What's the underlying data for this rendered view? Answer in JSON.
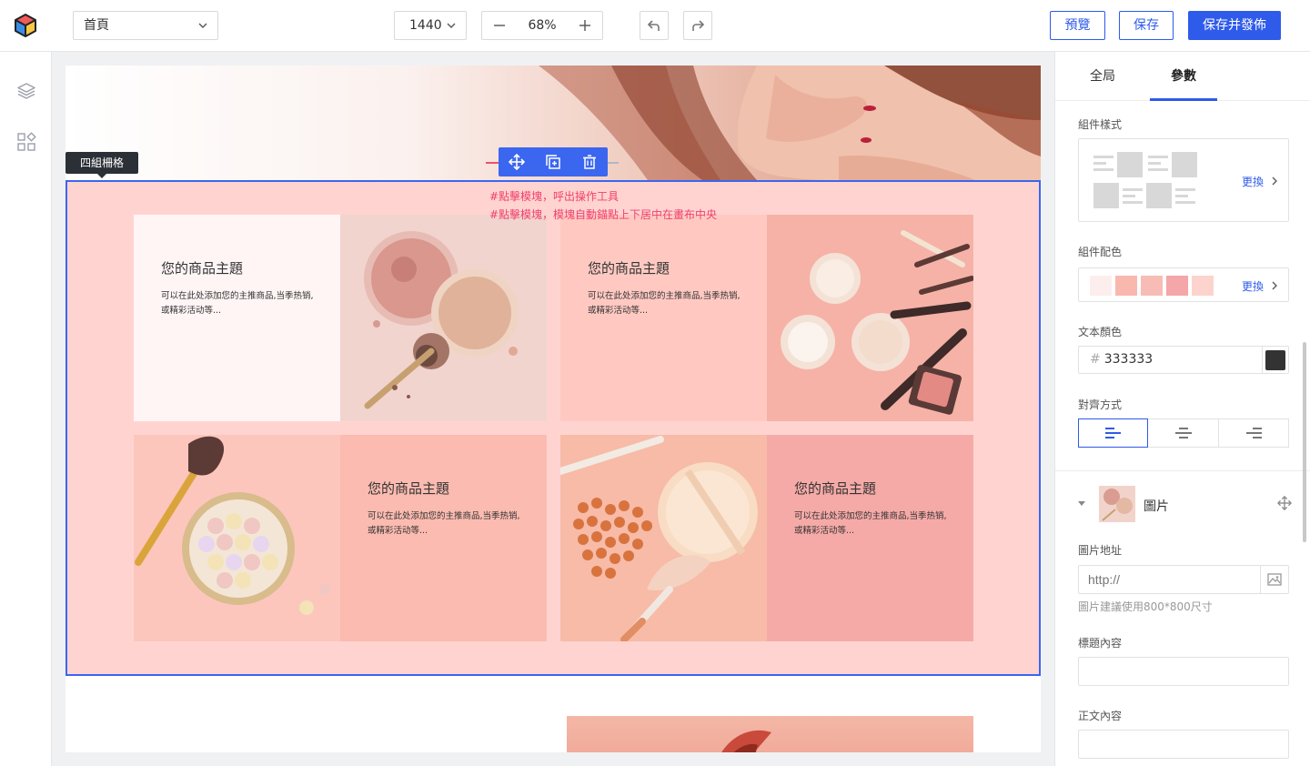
{
  "toolbar": {
    "page_select_value": "首頁",
    "width_select_value": "1440",
    "zoom_value": "68%",
    "preview_label": "預覽",
    "save_label": "保存",
    "publish_label": "保存并發佈"
  },
  "left_rail": {
    "icons": [
      "layers-icon",
      "components-grid-icon"
    ]
  },
  "canvas": {
    "selection_label": "四組柵格",
    "notes": [
      "#點擊模塊，呼出操作工具",
      "#點擊模塊，模塊自動錨點上下居中在畫布中央"
    ],
    "cards": [
      {
        "title": "您的商品主題",
        "desc": "可以在此处添加您的主推商品,当季热销,或精彩活动等..."
      },
      {
        "title": "您的商品主題",
        "desc": "可以在此处添加您的主推商品,当季热销,或精彩活动等..."
      },
      {
        "title": "您的商品主題",
        "desc": "可以在此处添加您的主推商品,当季热销,或精彩活动等..."
      },
      {
        "title": "您的商品主題",
        "desc": "可以在此处添加您的主推商品,当季热销,或精彩活动等..."
      }
    ]
  },
  "panel": {
    "tabs": [
      "全局",
      "參數"
    ],
    "active_tab": "參數",
    "component_style_label": "組件樣式",
    "component_color_label": "組件配色",
    "change_label": "更換",
    "palette": [
      "#fdeeee",
      "#f9b8ae",
      "#f8bcb6",
      "#f5a6a8",
      "#fcd4cd"
    ],
    "text_color_label": "文本顏色",
    "text_color_value": "333333",
    "align_label": "對齊方式",
    "align_options": [
      "left",
      "center",
      "right"
    ],
    "align_selected": "left",
    "image_item_label": "圖片",
    "image_url_label": "圖片地址",
    "image_url_placeholder": "http://",
    "image_hint": "圖片建議使用800*800尺寸",
    "title_content_label": "標題內容",
    "body_content_label": "正文內容"
  },
  "colors": {
    "accent": "#2f5bea",
    "note": "#f0406e",
    "section_bg": "#ffd4d0"
  }
}
